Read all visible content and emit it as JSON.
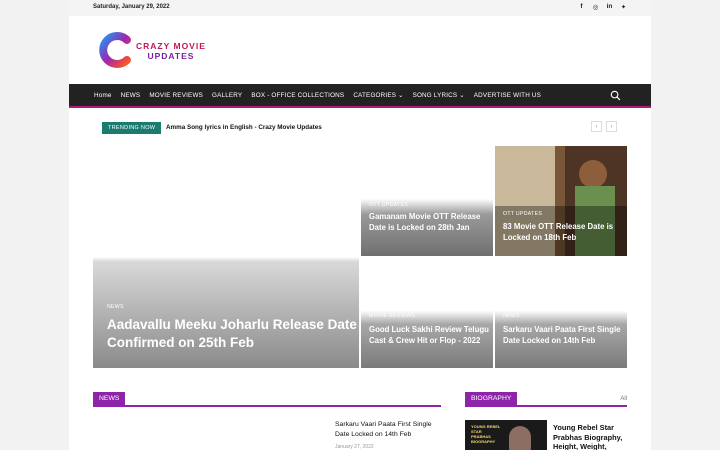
{
  "topbar": {
    "date": "Saturday, January 29, 2022",
    "social": [
      {
        "icon": "facebook-icon",
        "glyph": "f"
      },
      {
        "icon": "instagram-icon",
        "glyph": "◎"
      },
      {
        "icon": "linkedin-icon",
        "glyph": "in"
      },
      {
        "icon": "twitter-icon",
        "glyph": "✦"
      }
    ]
  },
  "logo": {
    "line1": "CRAZY MOVIE",
    "line2": "UPDATES"
  },
  "nav": {
    "items": [
      "Home",
      "NEWS",
      "MOVIE REVIEWS",
      "GALLERY",
      "BOX - OFFICE COLLECTIONS",
      "CATEGORIES ⌄",
      "SONG LYRICS ⌄",
      "ADVERTISE WITH US"
    ]
  },
  "trending": {
    "label": "TRENDING NOW",
    "title": "Amma Song lyrics in English - Crazy Movie Updates",
    "prev": "‹",
    "next": "›"
  },
  "featured": {
    "main": {
      "category": "NEWS",
      "title": "Aadavallu Meeku Joharlu Release Date Confirmed on 25th Feb"
    },
    "tile_a": {
      "category": "OTT UPDATES",
      "title": "Gamanam Movie OTT Release Date is Locked on 28th Jan"
    },
    "tile_b": {
      "category": "OTT UPDATES",
      "title": "83 Movie OTT Release Date is Locked on 18th Feb"
    },
    "tile_c": {
      "category": "MOVIE REVIEWS",
      "title": "Good Luck Sakhi Review Telugu Cast & Crew Hit or Flop - 2022"
    },
    "tile_d": {
      "category": "NEWS",
      "title": "Sarkaru Vaari Paata First Single Date Locked on 14th Feb"
    }
  },
  "news_section": {
    "label": "NEWS",
    "item_title": "Sarkaru Vaari Paata First Single Date Locked on 14th Feb",
    "item_date": "January 27, 2022"
  },
  "bio_section": {
    "label": "BIOGRAPHY",
    "all": "All",
    "thumb_caption": "YOUNG REBEL STAR PRABHAS BIOGRAPHY",
    "item_title": "Young Rebel Star Prabhas Biography, Height, Weight,"
  },
  "colors": {
    "accent": "#8e24aa",
    "nav_bg": "#222222",
    "trend": "#1b7b6e"
  }
}
